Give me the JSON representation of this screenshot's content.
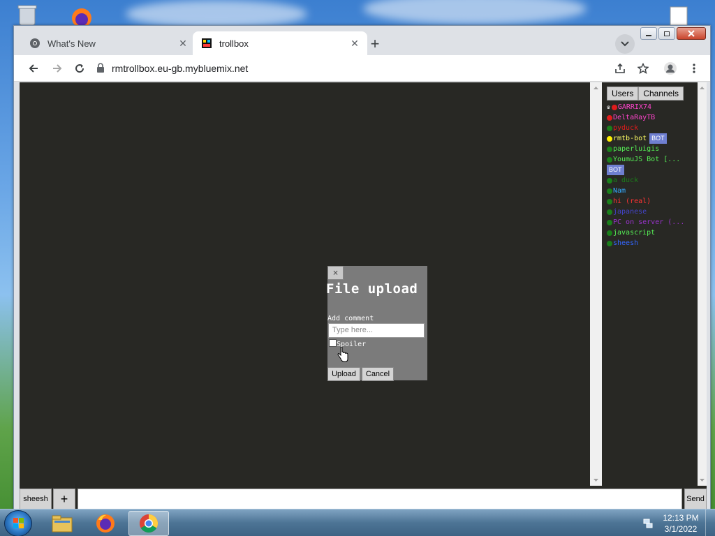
{
  "browser": {
    "tabs": [
      {
        "label": "What's New",
        "active": false,
        "icon": "chrome-icon"
      },
      {
        "label": "trollbox",
        "active": true,
        "icon": "trollbox-favicon"
      }
    ],
    "new_tab_label": "+",
    "close_glyph": "✕",
    "url": "rmtrollbox.eu-gb.mybluemix.net"
  },
  "sidebar": {
    "tabs": [
      "Users",
      "Channels"
    ],
    "bot_label": "BOT",
    "users": [
      {
        "name": "GARRIX74",
        "color": "#ff44cc",
        "dot": "#e01c1c",
        "crown": true,
        "bot": false
      },
      {
        "name": "DeltaRayTB",
        "color": "#ff44cc",
        "dot": "#e01c1c",
        "crown": false,
        "bot": false
      },
      {
        "name": "pyduck",
        "color": "#e01c1c",
        "dot": "#1a7f1a",
        "crown": false,
        "bot": false
      },
      {
        "name": "rmtb-bot",
        "color": "#ffff66",
        "dot": "#ffef00",
        "crown": false,
        "bot": true
      },
      {
        "name": "paperluigis",
        "color": "#55ee55",
        "dot": "#1a7f1a",
        "crown": false,
        "bot": false
      },
      {
        "name": "YoumuJS Bot [...",
        "color": "#55ee55",
        "dot": "#1a7f1a",
        "crown": false,
        "bot": true
      },
      {
        "name": "a duck",
        "color": "#1a7f1a",
        "dot": "#1a7f1a",
        "crown": false,
        "bot": false
      },
      {
        "name": "Nam",
        "color": "#33aaff",
        "dot": "#1a7f1a",
        "crown": false,
        "bot": false
      },
      {
        "name": "hi (real)",
        "color": "#ff3333",
        "dot": "#1a7f1a",
        "crown": false,
        "bot": false
      },
      {
        "name": "japanese",
        "color": "#4444cc",
        "dot": "#1a7f1a",
        "crown": false,
        "bot": false
      },
      {
        "name": "PC on server (...",
        "color": "#9933cc",
        "dot": "#1a7f1a",
        "crown": false,
        "bot": false
      },
      {
        "name": "javascript",
        "color": "#55ee55",
        "dot": "#1a7f1a",
        "crown": false,
        "bot": false
      },
      {
        "name": "sheesh",
        "color": "#3366ff",
        "dot": "#1a7f1a",
        "crown": false,
        "bot": false
      }
    ]
  },
  "modal": {
    "close_glyph": "×",
    "title": "File upload",
    "comment_label": "Add comment",
    "comment_placeholder": "Type here...",
    "spoiler_label": "Spoiler",
    "upload_label": "Upload",
    "cancel_label": "Cancel"
  },
  "input_bar": {
    "nick": "sheesh",
    "plus": "+",
    "send": "Send"
  },
  "taskbar": {
    "time": "12:13 PM",
    "date": "3/1/2022"
  }
}
